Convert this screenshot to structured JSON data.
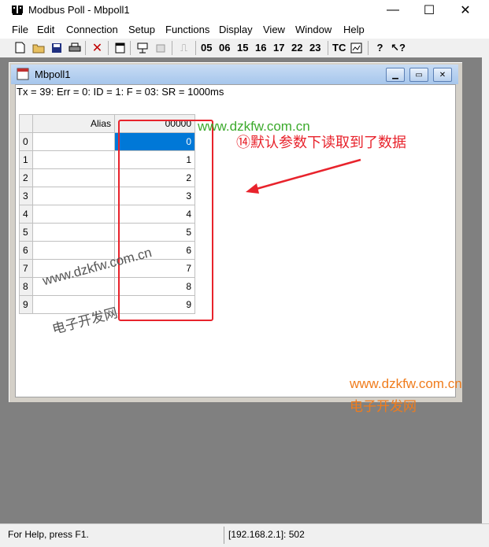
{
  "window": {
    "title": "Modbus Poll - Mbpoll1",
    "minimize": "—",
    "maximize": "☐",
    "close": "✕"
  },
  "menubar": [
    "File",
    "Edit",
    "Connection",
    "Setup",
    "Functions",
    "Display",
    "View",
    "Window",
    "Help"
  ],
  "toolbar": {
    "codes": [
      "05",
      "06",
      "15",
      "16",
      "17",
      "22",
      "23",
      "TC"
    ]
  },
  "mdi": {
    "title": "Mbpoll1",
    "status": "Tx = 39: Err = 0: ID = 1: F = 03: SR = 1000ms",
    "columns": {
      "alias": "Alias",
      "address": "00000"
    },
    "rows": [
      {
        "index": "0",
        "value": "0"
      },
      {
        "index": "1",
        "value": "1"
      },
      {
        "index": "2",
        "value": "2"
      },
      {
        "index": "3",
        "value": "3"
      },
      {
        "index": "4",
        "value": "4"
      },
      {
        "index": "5",
        "value": "5"
      },
      {
        "index": "6",
        "value": "6"
      },
      {
        "index": "7",
        "value": "7"
      },
      {
        "index": "8",
        "value": "8"
      },
      {
        "index": "9",
        "value": "9"
      }
    ]
  },
  "annotation": {
    "url": "www.dzkfw.com.cn",
    "text": "⑭默认参数下读取到了数据",
    "color": "#e8232c"
  },
  "watermarks": {
    "url": "www.dzkfw.com.cn",
    "cn": "电子开发网"
  },
  "statusbar": {
    "help": "For Help, press F1.",
    "connection": "[192.168.2.1]: 502"
  }
}
